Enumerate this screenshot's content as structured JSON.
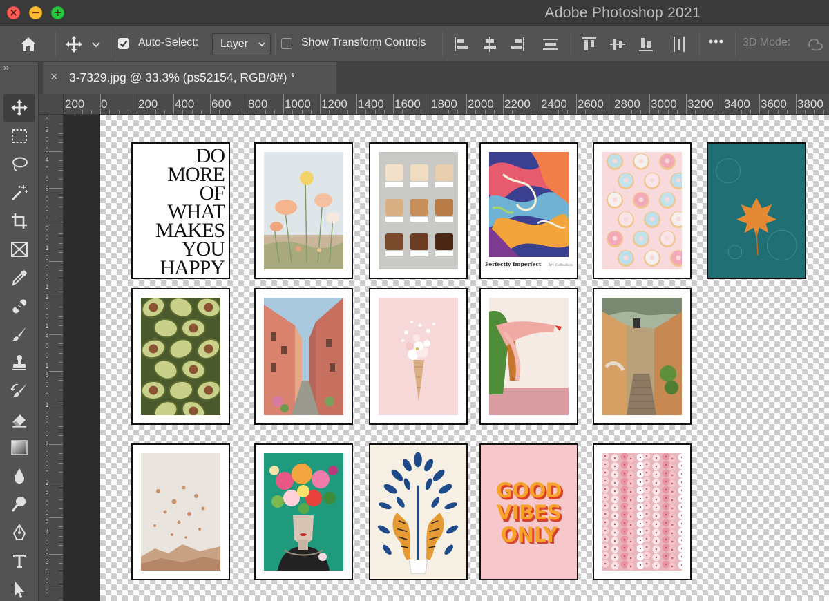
{
  "window": {
    "title": "Adobe Photoshop 2021",
    "controls": {
      "close": "×",
      "minimize": "−",
      "zoom": "+"
    }
  },
  "options_bar": {
    "auto_select_label": "Auto-Select:",
    "auto_select_checked": true,
    "auto_select_value": "Layer",
    "show_transform_label": "Show Transform Controls",
    "show_transform_checked": false,
    "more_label": "•••",
    "mode_3d_label": "3D Mode:"
  },
  "toolbar": {
    "collapse": "››",
    "tools": [
      "move",
      "rectangular-marquee",
      "lasso",
      "magic-wand",
      "crop",
      "frame",
      "eyedropper",
      "healing-brush",
      "brush",
      "clone-stamp",
      "history-brush",
      "eraser",
      "gradient",
      "blur",
      "dodge",
      "pen",
      "type",
      "path-selection"
    ],
    "active_tool": "move"
  },
  "document": {
    "tab_title": "3-7329.jpg @ 33.3% (ps52154, RGB/8#) *",
    "close_glyph": "×"
  },
  "ruler": {
    "h_labels": [
      "200",
      "0",
      "200",
      "400",
      "600",
      "800",
      "1000",
      "1200",
      "1400",
      "1600",
      "1800",
      "2000",
      "2200",
      "2400",
      "2600",
      "2800",
      "3000",
      "3200",
      "3400",
      "3600",
      "3800"
    ],
    "v_labels": [
      "0",
      "2",
      "0",
      "0",
      "4",
      "0",
      "0",
      "6",
      "0",
      "0",
      "8",
      "0",
      "0",
      "1",
      "0",
      "0",
      "0",
      "1",
      "2",
      "0",
      "0",
      "1",
      "4",
      "0",
      "0",
      "1",
      "6",
      "0",
      "0",
      "1",
      "8",
      "0",
      "0",
      "2",
      "0",
      "0",
      "0",
      "2",
      "2",
      "0",
      "0",
      "2",
      "4",
      "0",
      "0",
      "2",
      "6",
      "0",
      "0"
    ]
  },
  "posters": {
    "typography_lines": [
      "DO",
      "MORE",
      "OF",
      "WHAT",
      "MAKES",
      "YOU",
      "HAPPY"
    ],
    "abstract_caption": "Perfectly Imperfect",
    "abstract_signature": "Art Collection",
    "good_vibes_lines": [
      "GOOD",
      "VIBES",
      "ONLY"
    ]
  },
  "colors": {
    "chrome": "#535353",
    "title_bar": "#3a3a3a",
    "pasteboard": "#2c2c2c",
    "accent_orange": "#f7a22b",
    "accent_red": "#d9412b"
  }
}
